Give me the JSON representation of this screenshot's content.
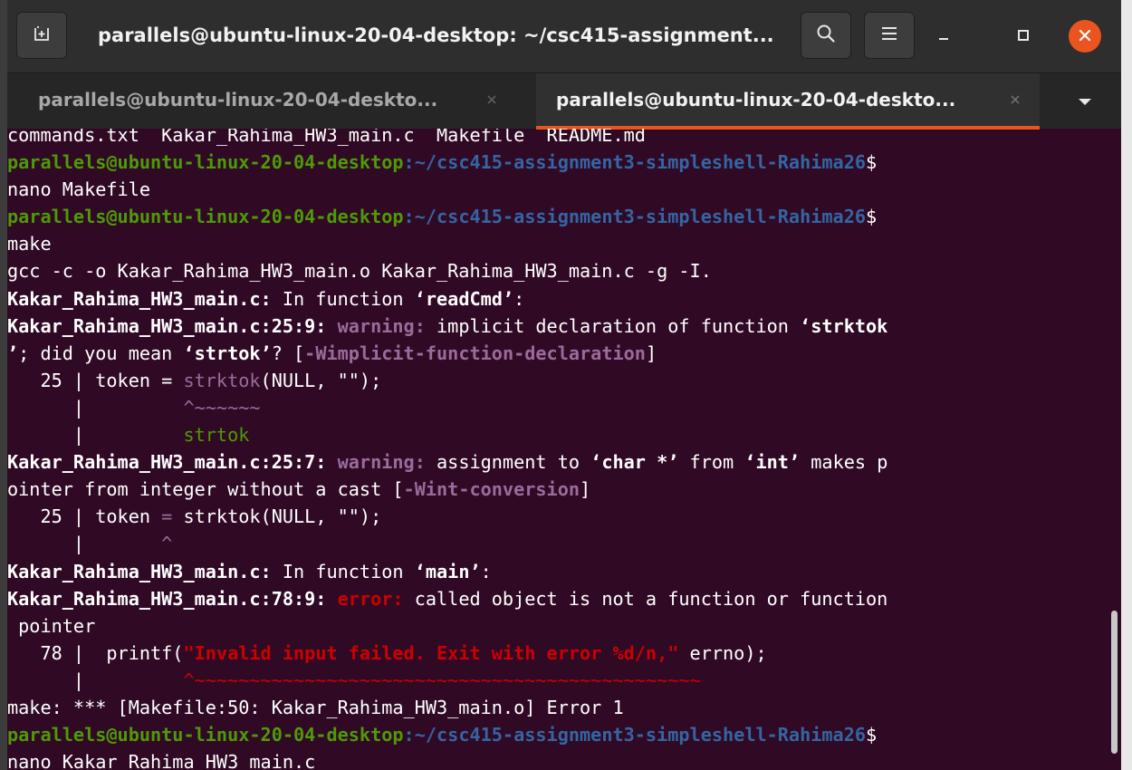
{
  "window": {
    "title": "parallels@ubuntu-linux-20-04-desktop: ~/csc415-assignment..."
  },
  "icons": {
    "new_tab": "new-tab-icon",
    "search": "search-icon",
    "menu": "hamburger-menu-icon",
    "minimize": "minimize-icon",
    "maximize": "maximize-icon",
    "close": "close-icon",
    "tab_close": "close-icon",
    "dropdown": "chevron-down-icon"
  },
  "colors": {
    "terminal_bg": "#300a24",
    "prompt_user": "#4e9a06",
    "prompt_path": "#3465a4",
    "warning": "#9a6b9c",
    "error": "#cc0000",
    "accent": "#e95420"
  },
  "tabs": [
    {
      "label": "parallels@ubuntu-linux-20-04-deskto...",
      "active": false
    },
    {
      "label": "parallels@ubuntu-linux-20-04-deskto...",
      "active": true
    }
  ],
  "terminal": {
    "prompt_user": "parallels@ubuntu-linux-20-04-desktop",
    "prompt_path": ":~/csc415-assignment3-simpleshell-Rahima26",
    "prompt_dollar": "$",
    "partial_top_line": "commands.txt  Kakar_Rahima_HW3_main.c  Makefile  README.md",
    "cmd_nano_makefile": "nano Makefile",
    "cmd_make": "make",
    "gcc_line": "gcc -c -o Kakar_Rahima_HW3_main.o Kakar_Rahima_HW3_main.c -g -I.",
    "file_name": "Kakar_Rahima_HW3_main.c:",
    "in_function": " In function ",
    "readcmd_func": "‘readCmd’",
    "colon": ":",
    "loc_25_9": "Kakar_Rahima_HW3_main.c:25:9:",
    "warning_label": " warning:",
    "w1_msg_a": " implicit declaration of function ",
    "w1_func": "‘strktok",
    "w1_func_end": "’",
    "w1_msg_b": "; did you mean ",
    "w1_suggest": "‘strtok’",
    "w1_msg_c": "? [",
    "w1_flag": "-Wimplicit-function-declaration",
    "close_bracket": "]",
    "src25_prefix": "   25 | token = ",
    "src25_hl": "strktok",
    "src25_rest": "(NULL, \"\");",
    "gutter": "      |         ",
    "caret1": "^~~~~~~",
    "fixit": "strtok",
    "loc_25_7": "Kakar_Rahima_HW3_main.c:25:7:",
    "w2_msg_a": " assignment to ",
    "w2_t1": "‘char *’",
    "w2_from": " from ",
    "w2_t2": "‘int’",
    "w2_msg_b": " makes p",
    "w2_wrap": "ointer from integer without a cast [",
    "w2_flag": "-Wint-conversion",
    "src25b_prefix": "   25 | token ",
    "src25b_eq": "=",
    "src25b_rest": " strktok(NULL, \"\");",
    "gutter2": "      |       ",
    "caret2": "^",
    "main_func": "‘main’",
    "loc_78_9": "Kakar_Rahima_HW3_main.c:78:9:",
    "error_label": " error:",
    "e1_msg": " called object is not a function or function",
    "e1_wrap": " pointer",
    "src78_prefix": "   78 |  printf(",
    "src78_str": "\"Invalid input failed. Exit with error %d/n,\"",
    "src78_rest": " errno);",
    "caret3": "^~~~~~~~~~~~~~~~~~~~~~~~~~~~~~~~~~~~~~~~~~~~~~~",
    "make_error": "make: *** [Makefile:50: Kakar_Rahima_HW3_main.o] Error 1",
    "cmd_nano_main": "nano Kakar_Rahima_HW3_main.c"
  }
}
